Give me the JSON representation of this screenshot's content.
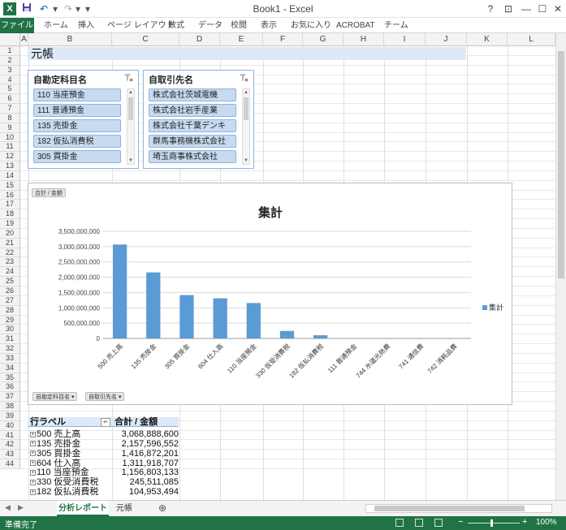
{
  "window": {
    "title": "Book1 - Excel",
    "app_icon": "X",
    "controls": {
      "help": "?",
      "restore_ribbon": "⊡",
      "minimize": "—",
      "maximize": "☐",
      "close": "✕"
    }
  },
  "quick_access": {
    "save_icon": "floppy-icon",
    "undo": "↶",
    "redo": "↷",
    "customize": "▾"
  },
  "ribbon": {
    "file_tab": "ファイル",
    "tabs": [
      "ホーム",
      "挿入",
      "ページ レイアウト",
      "数式",
      "データ",
      "校閲",
      "表示",
      "お気に入り",
      "ACROBAT",
      "チーム"
    ]
  },
  "columns": [
    "A",
    "B",
    "C",
    "D",
    "E",
    "F",
    "G",
    "H",
    "I",
    "J",
    "K",
    "L"
  ],
  "rows": [
    "1",
    "2",
    "3",
    "4",
    "5",
    "6",
    "7",
    "8",
    "9",
    "10",
    "11",
    "12",
    "13",
    "14",
    "15",
    "16",
    "17",
    "18",
    "19",
    "20",
    "21",
    "22",
    "23",
    "24",
    "25",
    "26",
    "27",
    "28",
    "29",
    "30",
    "31",
    "32",
    "33",
    "34",
    "35",
    "36",
    "37",
    "38",
    "39",
    "40",
    "41",
    "42",
    "43",
    "44"
  ],
  "sheet_title": "元帳",
  "slicers": [
    {
      "title": "自勘定科目名",
      "items": [
        "110 当座預金",
        "111 普通預金",
        "135 売掛金",
        "182 仮払消費税",
        "305 買掛金"
      ]
    },
    {
      "title": "自取引先名",
      "items": [
        "株式会社茨城電機",
        "株式会社岩手産業",
        "株式会社千葉デンキ",
        "群馬事務機株式会社",
        "埼玉商事株式会社"
      ]
    }
  ],
  "chart_fields": {
    "value_field": "合計 / 金額",
    "filter_fields": [
      "自勘定科目名 ▾",
      "自取引先名 ▾"
    ]
  },
  "chart_data": {
    "type": "bar",
    "title": "集計",
    "xlabel": "",
    "ylabel": "",
    "ylim": [
      0,
      3500000000
    ],
    "yticks": [
      "0",
      "500,000,000",
      "1,000,000,000",
      "1,500,000,000",
      "2,000,000,000",
      "2,500,000,000",
      "3,000,000,000",
      "3,500,000,000"
    ],
    "categories": [
      "500 売上高",
      "135 売掛金",
      "305 買掛金",
      "604 仕入高",
      "110 当座預金",
      "330 仮受消費税",
      "182 仮払消費税",
      "111 普通預金",
      "744 水道光熱費",
      "741 通信費",
      "742 消耗品費"
    ],
    "series": [
      {
        "name": "集計",
        "values": [
          3068888600,
          2157596552,
          1416872201,
          1311918707,
          1156803133,
          245511085,
          104953494,
          0,
          0,
          0,
          0
        ]
      }
    ],
    "legend": "right",
    "grid": true,
    "bar_color": "#5b9bd5"
  },
  "pivot": {
    "row_label_header": "行ラベル",
    "value_header": "合計 / 金額",
    "filter_icon": "↵",
    "rows": [
      {
        "label": "500 売上高",
        "value": "3,068,888,600"
      },
      {
        "label": "135 売掛金",
        "value": "2,157,596,552"
      },
      {
        "label": "305 買掛金",
        "value": "1,416,872,201"
      },
      {
        "label": "604 仕入高",
        "value": "1,311,918,707"
      },
      {
        "label": "110 当座預金",
        "value": "1,156,803,133"
      },
      {
        "label": "330 仮受消費税",
        "value": "245,511,085"
      },
      {
        "label": "182 仮払消費税",
        "value": "104,953,494"
      }
    ]
  },
  "sheet_tabs": {
    "active": "分析レポート",
    "other": "元帳",
    "add": "⊕"
  },
  "status": {
    "text": "準備完了",
    "zoom": "100%",
    "zoom_minus": "−",
    "zoom_plus": "+"
  }
}
